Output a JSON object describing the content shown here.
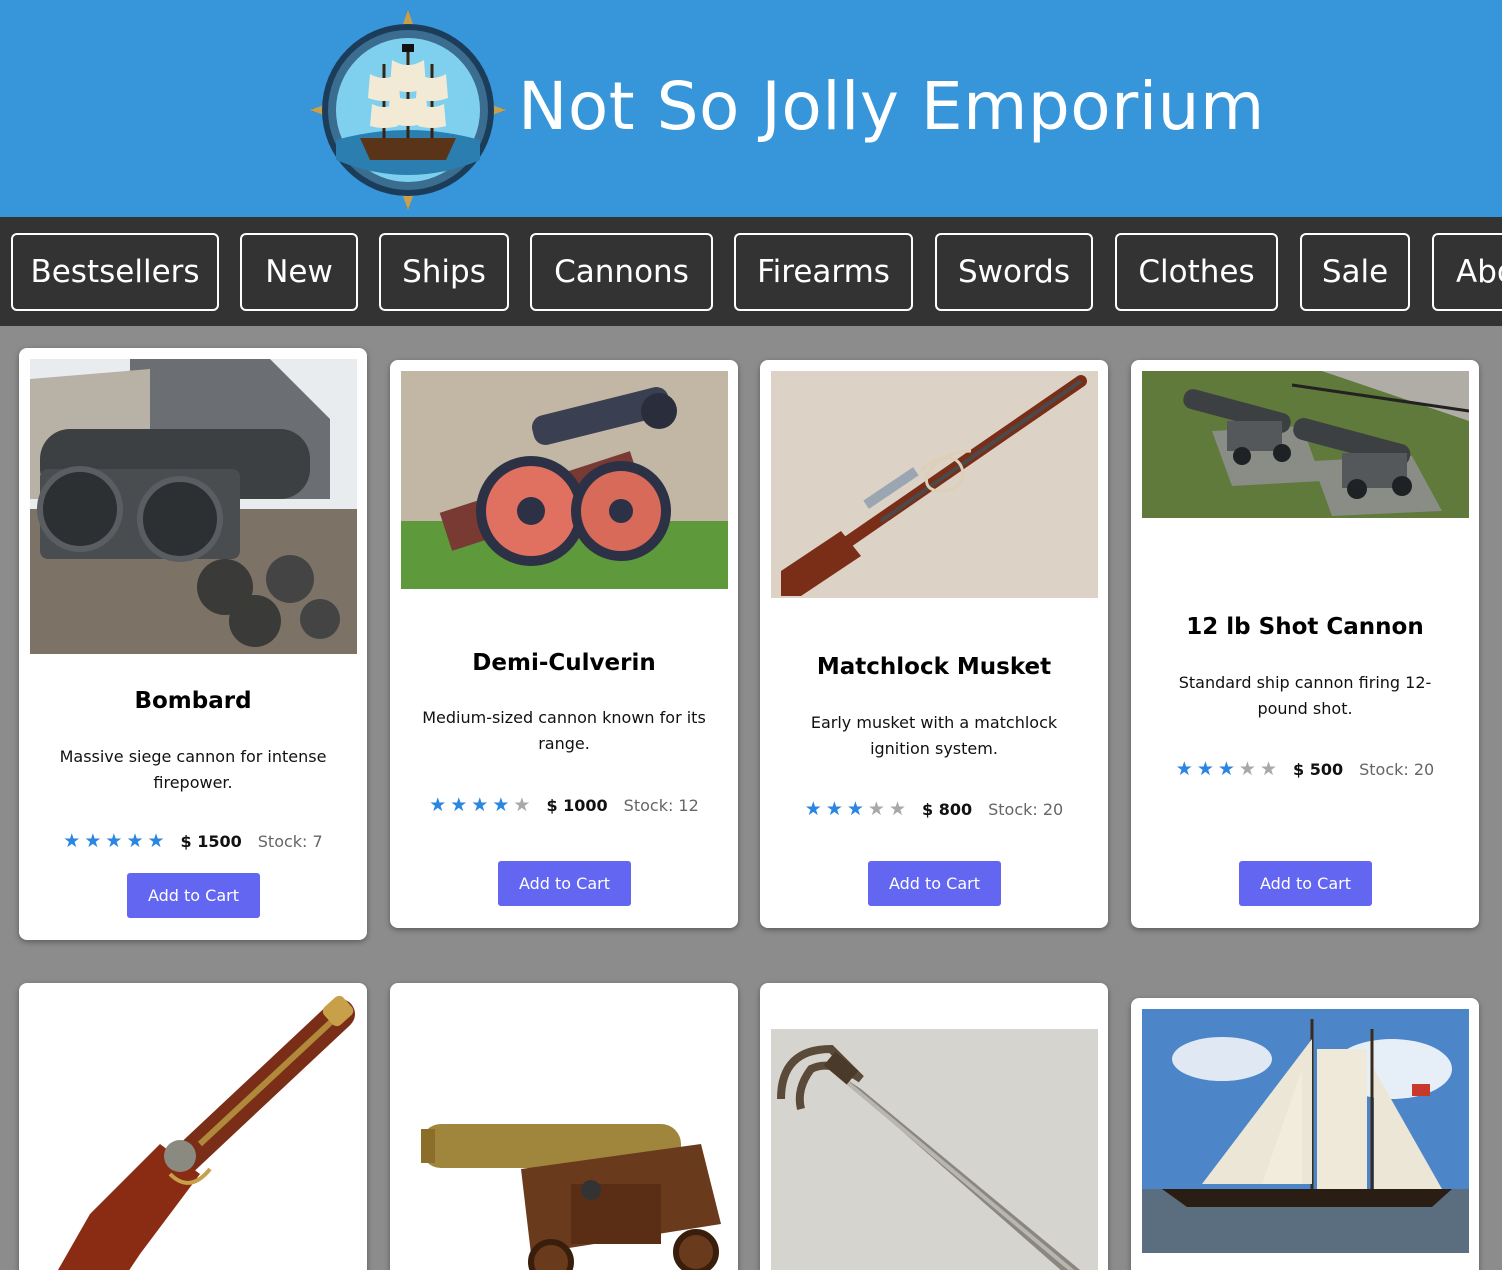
{
  "site": {
    "title": "Not So Jolly Emporium"
  },
  "nav": [
    {
      "label": "Bestsellers"
    },
    {
      "label": "New"
    },
    {
      "label": "Ships"
    },
    {
      "label": "Cannons"
    },
    {
      "label": "Firearms"
    },
    {
      "label": "Swords"
    },
    {
      "label": "Clothes"
    },
    {
      "label": "Sale"
    },
    {
      "label": "Abo"
    }
  ],
  "colors": {
    "header": "#3795d9",
    "nav": "#333333",
    "page": "#8c8c8c",
    "button": "#6366f1",
    "star": "#2a86e0"
  },
  "products": [
    {
      "name": "Bombard",
      "description": "Massive siege cannon for intense firepower.",
      "rating": 5,
      "price": "$ 1500",
      "stock": "Stock: 7",
      "button": "Add to Cart",
      "image": "cannon-image"
    },
    {
      "name": "Demi-Culverin",
      "description": "Medium-sized cannon known for its range.",
      "rating": 4,
      "price": "$ 1000",
      "stock": "Stock: 12",
      "button": "Add to Cart",
      "image": "cannon-image"
    },
    {
      "name": "Matchlock Musket",
      "description": "Early musket with a matchlock ignition system.",
      "rating": 3,
      "price": "$ 800",
      "stock": "Stock: 20",
      "button": "Add to Cart",
      "image": "musket-image"
    },
    {
      "name": "12 lb Shot Cannon",
      "description": "Standard ship cannon firing 12-pound shot.",
      "rating": 3,
      "price": "$ 500",
      "stock": "Stock: 20",
      "button": "Add to Cart",
      "image": "cannon-image"
    },
    {
      "image": "flintlock-pistol-image"
    },
    {
      "image": "bronze-cannon-image"
    },
    {
      "image": "sword-image"
    },
    {
      "image": "ship-image"
    }
  ]
}
